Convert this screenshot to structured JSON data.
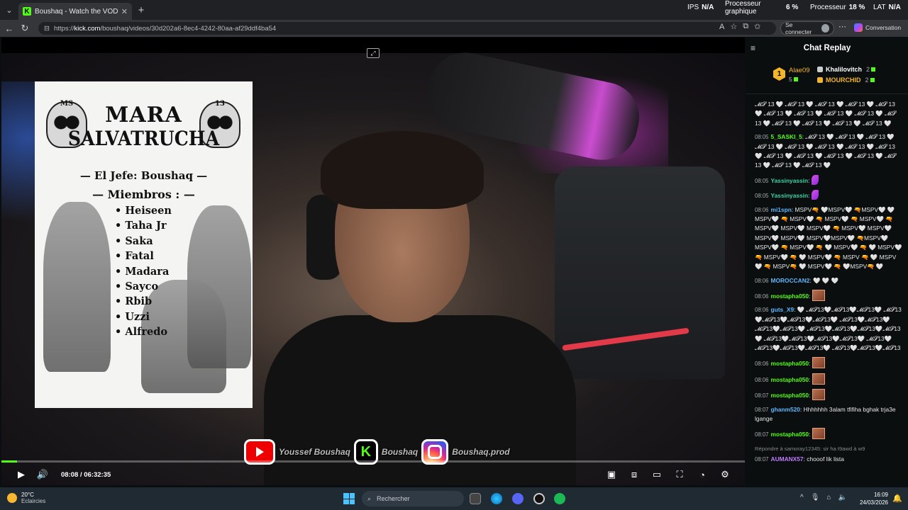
{
  "browser": {
    "tab_title": "Boushaq - Watch the VOD on Kick",
    "tab_favicon": "K",
    "url_prefix": "https://",
    "url_domain": "kick.com",
    "url_path": "/boushaq/videos/30d202a6-8ec4-4242-80aa-af29ddf4ba54",
    "signin_label": "Se connecter",
    "copilot_label": "Conversation"
  },
  "perf_overlay": {
    "ips_label": "IPS",
    "ips_value": "N/A",
    "gpu_label_1": "Processeur",
    "gpu_label_2": "graphique",
    "gpu_value": "6 %",
    "cpu_label": "Processeur",
    "cpu_value": "18 %",
    "lat_label": "LAT",
    "lat_value": "N/A"
  },
  "poster": {
    "ms_left": "MS",
    "ms_right": "13",
    "title_line1": "MARA",
    "title_line2": "SALVATRUCHA",
    "jefe": "— El Jefe: Boushaq —",
    "miembros": "— Miembros : —",
    "members": [
      "Heiseen",
      "Taha Jr",
      "Saka",
      "Fatal",
      "Madara",
      "Sayco",
      "Rbib",
      "Uzzi",
      "Alfredo"
    ]
  },
  "socials": {
    "youtube": "Youssef Boushaq",
    "kick": "Boushaq",
    "instagram": "Boushaq.prod"
  },
  "player": {
    "current_time": "08:08",
    "separator": "/",
    "duration": "06:32:35",
    "progress_fraction": 0.0206
  },
  "chat": {
    "title": "Chat Replay",
    "leaderboard": {
      "first_rank": "1",
      "first_name": "Alae09",
      "first_count": "5",
      "second_name": "Khalilovitch",
      "second_count": "2",
      "third_name": "MOURCHID",
      "third_count": "2"
    },
    "messages": [
      {
        "ts": "",
        "user": "",
        "user_color": "#ffffff",
        "text": "𝓜𝓢 13 🤍 𝓜𝓢 13 🤍 𝓜𝓢 13 🤍 𝓜𝓢 13 🤍 𝓜𝓢 13 🤍 𝓜𝓢 13 🤍 𝓜𝓢 13 🤍 𝓜𝓢 13 🤍 𝓜𝓢 13 🤍 𝓜𝓢 13 🤍 𝓜𝓢 13 🤍 𝓜𝓢 13 🤍 𝓜𝓢 13 🤍 𝓜𝓢 13 🤍"
      },
      {
        "ts": "08:05",
        "user": "5_SASKI_5",
        "user_color": "#53fc18",
        "text": "𝓜𝓢 13 🤍 𝓜𝓢 13 🤍 𝓜𝓢 13 🤍 𝓜𝓢 13 🤍 𝓜𝓢 13 🤍 𝓜𝓢 13 🤍 𝓜𝓢 13 🤍 𝓜𝓢 13 🤍 𝓜𝓢 13 🤍 𝓜𝓢 13 🤍 𝓜𝓢 13 🤍 𝓜𝓢 13 🤍 𝓜𝓢 13 🤍 𝓜𝓢 13 🤍 𝓜𝓢 13 🤍"
      },
      {
        "ts": "08:05",
        "user": "Yassinyassin",
        "user_color": "#3fd3a0",
        "text": "",
        "emote": "feather"
      },
      {
        "ts": "08:05",
        "user": "Yassinyassin",
        "user_color": "#3fd3a0",
        "text": "",
        "emote": "feather"
      },
      {
        "ts": "08:06",
        "user": "mi1spn",
        "user_color": "#5db7ff",
        "text": "MSPV🔫 🤍MSPV🤍 🔫MSPV🤍 🤍 MSPV🤍 🔫 MSPV🤍 🔫 MSPV🤍 🔫 MSPV🤍 🔫 MSPV🤍 MSPV🤍 MSPV🤍 🔫 MSPV🤍 MSPV🤍 MSPV🤍 MSPV🤍 MSPV🤍MSPV🤍 🔫MSPV🤍 MSPV🤍 🔫 MSPV🤍 🔫 🤍 MSPV🤍 🔫 🤍 MSPV🤍 🔫 MSPV🤍 🔫 🤍 MSPV🤍 🔫 MSPV 🔫 🤍 MSPV🤍 🔫 MSPV🔫 🤍 MSPV🤍 🔫 🤍MSPV🔫 🤍"
      },
      {
        "ts": "08:06",
        "user": "MOROCCAN2",
        "user_color": "#5db7ff",
        "text": "🤍 🤍 🤍"
      },
      {
        "ts": "08:06",
        "user": "mostapha050",
        "user_color": "#53fc18",
        "text": "",
        "emote": "pic"
      },
      {
        "ts": "08:06",
        "user": "guts_X9",
        "user_color": "#5db7ff",
        "text": "🤍 𝓜𝓢13🤍𝓜𝓢13🤍𝓜𝓢13🤍 𝓜𝓢13🤍𝓜𝓢13🤍𝓜𝓢13🤍𝓜𝓢13🤍 𝓜𝓢13🤍𝓜𝓢13🤍𝓜𝓢13🤍𝓜𝓢13🤍 𝓜𝓢13🤍𝓜𝓢13🤍𝓜𝓢13🤍𝓜𝓢13🤍 𝓜𝓢13🤍𝓜𝓢13🤍𝓜𝓢13🤍𝓜𝓢13🤍 𝓜𝓢13🤍𝓜𝓢13🤍𝓜𝓢13🤍𝓜𝓢13🤍 𝓜𝓢13🤍𝓜𝓢13🤍𝓜𝓢13"
      },
      {
        "ts": "08:06",
        "user": "mostapha050",
        "user_color": "#53fc18",
        "text": "",
        "emote": "pic"
      },
      {
        "ts": "08:06",
        "user": "mostapha050",
        "user_color": "#53fc18",
        "text": "",
        "emote": "pic"
      },
      {
        "ts": "08:07",
        "user": "mostapha050",
        "user_color": "#53fc18",
        "text": "",
        "emote": "pic"
      },
      {
        "ts": "08:07",
        "user": "ghanm520",
        "user_color": "#5db7ff",
        "text": "Hhhhhhh 3alam tfifiha bghak trja3e lgange"
      },
      {
        "ts": "08:07",
        "user": "mostapha050",
        "user_color": "#53fc18",
        "text": "",
        "emote": "pic"
      },
      {
        "ts": "08:07",
        "user": "AUMANX57",
        "user_color": "#c07bff",
        "text": "chooof lik lista",
        "reply": "Répondre à samoray12345: sir ha t9awd à w9"
      }
    ]
  },
  "taskbar": {
    "temp": "20°C",
    "weather": "Eclaircies",
    "search": "Rechercher",
    "time": "16:09",
    "date": "24/03/2026"
  },
  "colors": {
    "kick_green": "#53fc18",
    "accent_gold": "#f3b52a"
  }
}
